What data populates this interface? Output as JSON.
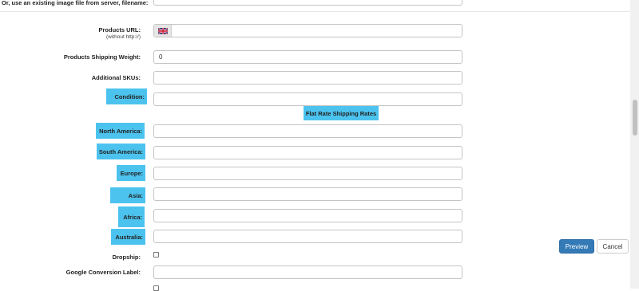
{
  "form": {
    "existing_image": {
      "label": "Or, use an existing image file from server, filename:",
      "value": ""
    },
    "products_url": {
      "label": "Products URL:",
      "sublabel": "(without http://)",
      "value": ""
    },
    "shipping_weight": {
      "label": "Products Shipping Weight:",
      "value": "0"
    },
    "additional_skus": {
      "label": "Additional SKUs:",
      "value": ""
    },
    "condition": {
      "label": "Condition:",
      "value": ""
    },
    "flat_rate_heading": "Flat Rate Shipping Rates",
    "regions": [
      {
        "label": "North America:",
        "value": ""
      },
      {
        "label": "South America:",
        "value": ""
      },
      {
        "label": "Europe:",
        "value": ""
      },
      {
        "label": "Asia:",
        "value": ""
      },
      {
        "label": "Africa:",
        "value": ""
      },
      {
        "label": "Australia:",
        "value": ""
      }
    ],
    "dropship": {
      "label": "Dropship:",
      "checked": false
    },
    "google_conversion": {
      "label": "Google Conversion Label:",
      "value": ""
    }
  },
  "actions": {
    "preview_label": "Preview",
    "cancel_label": "Cancel"
  },
  "colors": {
    "highlight": "#4cc3ee",
    "primary_button": "#337ab7"
  },
  "icons": {
    "language_flag": "uk-flag-icon"
  }
}
